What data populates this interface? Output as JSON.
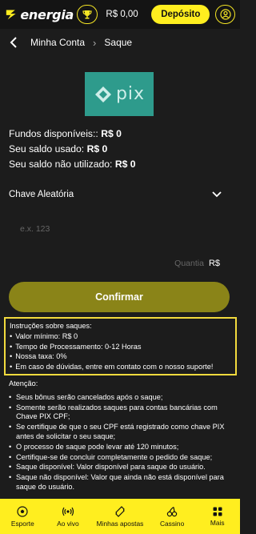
{
  "header": {
    "brand": "energia",
    "balance": "R$ 0,00",
    "deposit_label": "Depósito"
  },
  "breadcrumb": {
    "parent": "Minha Conta",
    "current": "Saque"
  },
  "pix_logo_text": "pix",
  "funds": {
    "available_label": "Fundos disponíveis::",
    "available_value": "R$ 0",
    "used_label": "Seu saldo usado:",
    "used_value": "R$ 0",
    "unused_label": "Seu saldo não utilizado:",
    "unused_value": "R$ 0"
  },
  "form": {
    "key_type": "Chave Aleatória",
    "key_placeholder": "e.x. 123",
    "amount_label": "Quantia",
    "amount_currency": "R$",
    "confirm_label": "Confirmar"
  },
  "instructions": {
    "title": "Instruções sobre saques:",
    "items": [
      "Valor mínimo: R$ 0",
      "Tempo de Processamento: 0-12 Horas",
      "Nossa taxa: 0%",
      "Em caso de dúvidas, entre em contato com o nosso suporte!"
    ]
  },
  "attention": {
    "title": "Atenção:",
    "items": [
      "Seus bônus serão cancelados após o saque;",
      "Somente serão realizados saques para contas bancárias com Chave PIX CPF;",
      "Se certifique de que o seu CPF está registrado como chave PIX antes de solicitar o seu saque;",
      "O processo de saque pode levar até 120 minutos;",
      "Certifique-se de concluir completamente o pedido de saque;",
      "Saque disponível: Valor disponível para saque do usuário.",
      "Saque não disponível: Valor que ainda não está disponível para saque do usuário."
    ]
  },
  "nav": {
    "items": [
      {
        "label": "Esporte",
        "icon": "soccer-ball-icon"
      },
      {
        "label": "Ao vivo",
        "icon": "live-broadcast-icon"
      },
      {
        "label": "Minhas apostas",
        "icon": "ticket-icon"
      },
      {
        "label": "Cassino",
        "icon": "cherries-icon"
      },
      {
        "label": "Mais",
        "icon": "grid-icon"
      }
    ]
  },
  "colors": {
    "accent": "#ffee1f",
    "confirm": "#8a8418",
    "pix": "#2e9b8c",
    "background": "#1c1c1c"
  }
}
